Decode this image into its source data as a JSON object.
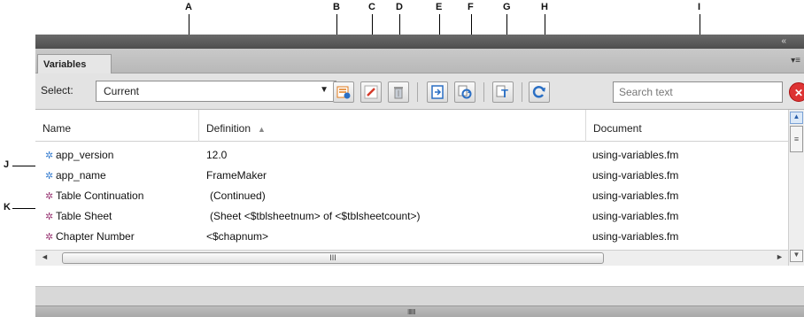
{
  "callouts": [
    "A",
    "B",
    "C",
    "D",
    "E",
    "F",
    "G",
    "H",
    "I",
    "J",
    "K"
  ],
  "panel": {
    "tab_label": "Variables",
    "collapse_glyph": "«",
    "menu_glyph": "▾≡"
  },
  "toolbar": {
    "select_label": "Select:",
    "select_value": "Current",
    "select_arrow": "▼",
    "search_placeholder": "Search text",
    "clear_glyph": "✕",
    "buttons": [
      {
        "name": "insert-variable",
        "icon": "insert-variable-icon"
      },
      {
        "name": "edit-variable",
        "icon": "pencil-icon"
      },
      {
        "name": "delete-variable",
        "icon": "trash-icon"
      },
      {
        "name": "convert-to-text",
        "icon": "convert-to-text-icon"
      },
      {
        "name": "update-variables",
        "icon": "update-variables-icon"
      },
      {
        "name": "show-text",
        "icon": "text-icon"
      },
      {
        "name": "refresh",
        "icon": "refresh-icon"
      }
    ]
  },
  "grid": {
    "columns": [
      "Name",
      "Definition",
      "Document"
    ],
    "sort_arrow": "▲",
    "rows": [
      {
        "name": "app_version",
        "definition": "12.0",
        "document": "using-variables.fm",
        "type": "user"
      },
      {
        "name": "app_name",
        "definition": "FrameMaker",
        "document": "using-variables.fm",
        "type": "user"
      },
      {
        "name": "Table Continuation",
        "definition": "(Continued)",
        "document": "using-variables.fm",
        "type": "system"
      },
      {
        "name": "Table Sheet",
        "definition": "(Sheet <$tblsheetnum> of <$tblsheetcount>)",
        "document": "using-variables.fm",
        "type": "system"
      },
      {
        "name": "Chapter Number",
        "definition": "<$chapnum>",
        "document": "using-variables.fm",
        "type": "system"
      }
    ],
    "hscroll_grip": "III",
    "vscroll_grip": "≡",
    "scroll_left": "◄",
    "scroll_right": "►",
    "scroll_up": "▲",
    "scroll_down": "▼"
  },
  "footer": {
    "grip": "IIIIIII"
  },
  "colors": {
    "user_var_icon": "#3a7fd0",
    "system_var_icon": "#9b3a76",
    "clear_button": "#dd3333"
  }
}
